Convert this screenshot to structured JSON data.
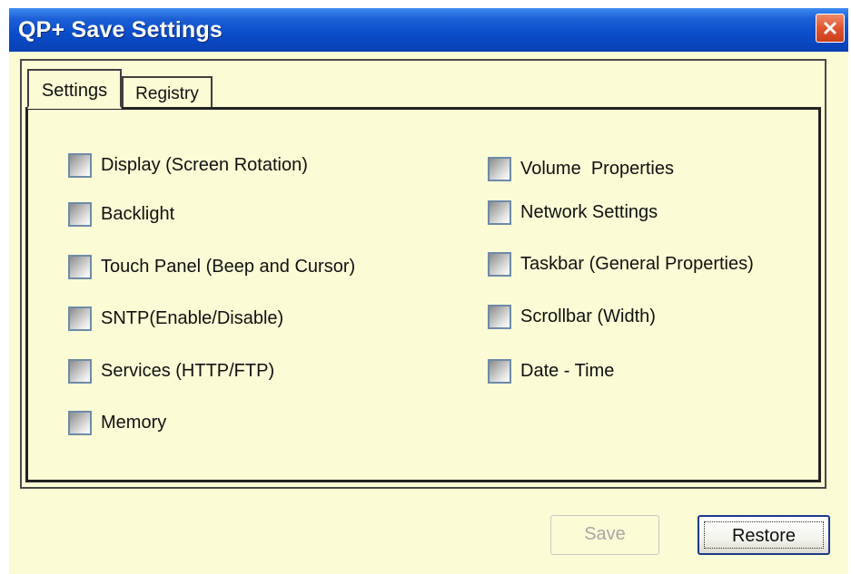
{
  "window": {
    "title": "QP+ Save Settings"
  },
  "tabs": [
    {
      "label": "Settings",
      "selected": true
    },
    {
      "label": "Registry",
      "selected": false
    }
  ],
  "settings": {
    "left_column": [
      {
        "label": "Display (Screen Rotation)",
        "checked": false
      },
      {
        "label": "Backlight",
        "checked": false
      },
      {
        "label": "Touch Panel (Beep and Cursor)",
        "checked": false
      },
      {
        "label": "SNTP(Enable/Disable)",
        "checked": false
      },
      {
        "label": "Services (HTTP/FTP)",
        "checked": false
      },
      {
        "label": "Memory",
        "checked": false
      }
    ],
    "right_column": [
      {
        "label": "Volume  Properties",
        "checked": false
      },
      {
        "label": "Network Settings",
        "checked": false
      },
      {
        "label": "Taskbar (General Properties)",
        "checked": false
      },
      {
        "label": "Scrollbar (Width)",
        "checked": false
      },
      {
        "label": "Date - Time",
        "checked": false
      }
    ]
  },
  "buttons": {
    "save": {
      "label": "Save",
      "enabled": false
    },
    "restore": {
      "label": "Restore",
      "enabled": true
    }
  },
  "colors": {
    "window_background": "#fbfbd6",
    "titlebar": "#0a4cc8",
    "close_button": "#e0552e"
  }
}
